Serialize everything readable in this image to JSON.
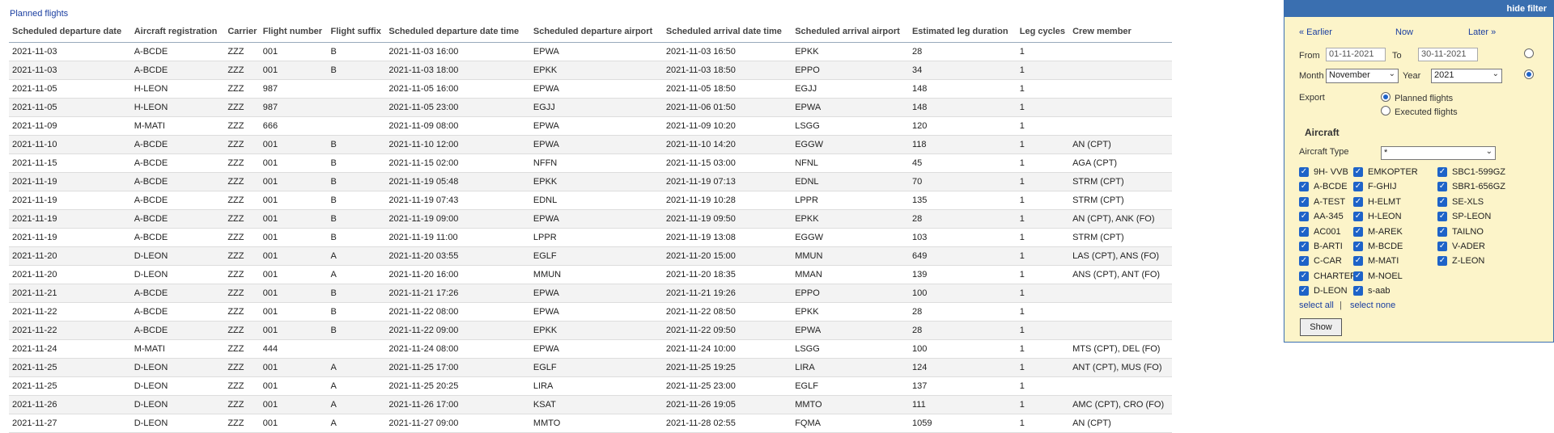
{
  "caption": "Planned flights",
  "columns": [
    "Scheduled departure date",
    "Aircraft registration",
    "Carrier",
    "Flight number",
    "Flight suffix",
    "Scheduled departure date time",
    "Scheduled departure airport",
    "Scheduled arrival date time",
    "Scheduled arrival airport",
    "Estimated leg duration",
    "Leg cycles",
    "Crew member"
  ],
  "rows": [
    [
      "2021-11-03",
      "A-BCDE",
      "ZZZ",
      "001",
      "B",
      "2021-11-03 16:00",
      "EPWA",
      "2021-11-03 16:50",
      "EPKK",
      "28",
      "1",
      ""
    ],
    [
      "2021-11-03",
      "A-BCDE",
      "ZZZ",
      "001",
      "B",
      "2021-11-03 18:00",
      "EPKK",
      "2021-11-03 18:50",
      "EPPO",
      "34",
      "1",
      ""
    ],
    [
      "2021-11-05",
      "H-LEON",
      "ZZZ",
      "987",
      "",
      "2021-11-05 16:00",
      "EPWA",
      "2021-11-05 18:50",
      "EGJJ",
      "148",
      "1",
      ""
    ],
    [
      "2021-11-05",
      "H-LEON",
      "ZZZ",
      "987",
      "",
      "2021-11-05 23:00",
      "EGJJ",
      "2021-11-06 01:50",
      "EPWA",
      "148",
      "1",
      ""
    ],
    [
      "2021-11-09",
      "M-MATI",
      "ZZZ",
      "666",
      "",
      "2021-11-09 08:00",
      "EPWA",
      "2021-11-09 10:20",
      "LSGG",
      "120",
      "1",
      ""
    ],
    [
      "2021-11-10",
      "A-BCDE",
      "ZZZ",
      "001",
      "B",
      "2021-11-10 12:00",
      "EPWA",
      "2021-11-10 14:20",
      "EGGW",
      "118",
      "1",
      "AN (CPT)"
    ],
    [
      "2021-11-15",
      "A-BCDE",
      "ZZZ",
      "001",
      "B",
      "2021-11-15 02:00",
      "NFFN",
      "2021-11-15 03:00",
      "NFNL",
      "45",
      "1",
      "AGA (CPT)"
    ],
    [
      "2021-11-19",
      "A-BCDE",
      "ZZZ",
      "001",
      "B",
      "2021-11-19 05:48",
      "EPKK",
      "2021-11-19 07:13",
      "EDNL",
      "70",
      "1",
      "STRM (CPT)"
    ],
    [
      "2021-11-19",
      "A-BCDE",
      "ZZZ",
      "001",
      "B",
      "2021-11-19 07:43",
      "EDNL",
      "2021-11-19 10:28",
      "LPPR",
      "135",
      "1",
      "STRM (CPT)"
    ],
    [
      "2021-11-19",
      "A-BCDE",
      "ZZZ",
      "001",
      "B",
      "2021-11-19 09:00",
      "EPWA",
      "2021-11-19 09:50",
      "EPKK",
      "28",
      "1",
      "AN (CPT), ANK (FO)"
    ],
    [
      "2021-11-19",
      "A-BCDE",
      "ZZZ",
      "001",
      "B",
      "2021-11-19 11:00",
      "LPPR",
      "2021-11-19 13:08",
      "EGGW",
      "103",
      "1",
      "STRM (CPT)"
    ],
    [
      "2021-11-20",
      "D-LEON",
      "ZZZ",
      "001",
      "A",
      "2021-11-20 03:55",
      "EGLF",
      "2021-11-20 15:00",
      "MMUN",
      "649",
      "1",
      "LAS (CPT), ANS (FO)"
    ],
    [
      "2021-11-20",
      "D-LEON",
      "ZZZ",
      "001",
      "A",
      "2021-11-20 16:00",
      "MMUN",
      "2021-11-20 18:35",
      "MMAN",
      "139",
      "1",
      "ANS (CPT), ANT (FO)"
    ],
    [
      "2021-11-21",
      "A-BCDE",
      "ZZZ",
      "001",
      "B",
      "2021-11-21 17:26",
      "EPWA",
      "2021-11-21 19:26",
      "EPPO",
      "100",
      "1",
      ""
    ],
    [
      "2021-11-22",
      "A-BCDE",
      "ZZZ",
      "001",
      "B",
      "2021-11-22 08:00",
      "EPWA",
      "2021-11-22 08:50",
      "EPKK",
      "28",
      "1",
      ""
    ],
    [
      "2021-11-22",
      "A-BCDE",
      "ZZZ",
      "001",
      "B",
      "2021-11-22 09:00",
      "EPKK",
      "2021-11-22 09:50",
      "EPWA",
      "28",
      "1",
      ""
    ],
    [
      "2021-11-24",
      "M-MATI",
      "ZZZ",
      "444",
      "",
      "2021-11-24 08:00",
      "EPWA",
      "2021-11-24 10:00",
      "LSGG",
      "100",
      "1",
      "MTS (CPT), DEL (FO)"
    ],
    [
      "2021-11-25",
      "D-LEON",
      "ZZZ",
      "001",
      "A",
      "2021-11-25 17:00",
      "EGLF",
      "2021-11-25 19:25",
      "LIRA",
      "124",
      "1",
      "ANT (CPT), MUS (FO)"
    ],
    [
      "2021-11-25",
      "D-LEON",
      "ZZZ",
      "001",
      "A",
      "2021-11-25 20:25",
      "LIRA",
      "2021-11-25 23:00",
      "EGLF",
      "137",
      "1",
      ""
    ],
    [
      "2021-11-26",
      "D-LEON",
      "ZZZ",
      "001",
      "A",
      "2021-11-26 17:00",
      "KSAT",
      "2021-11-26 19:05",
      "MMTO",
      "111",
      "1",
      "AMC (CPT), CRO (FO)"
    ],
    [
      "2021-11-27",
      "D-LEON",
      "ZZZ",
      "001",
      "A",
      "2021-11-27 09:00",
      "MMTO",
      "2021-11-28 02:55",
      "FQMA",
      "1059",
      "1",
      "AN (CPT)"
    ]
  ],
  "filter": {
    "hide_label": "hide filter",
    "earlier": "« Earlier",
    "now": "Now",
    "later": "Later »",
    "from_label": "From",
    "from_value": "01-11-2021",
    "to_label": "To",
    "to_value": "30-11-2021",
    "month_label": "Month",
    "month_value": "November",
    "year_label": "Year",
    "year_value": "2021",
    "export_label": "Export",
    "export_planned": "Planned flights",
    "export_executed": "Executed flights",
    "aircraft_heading": "Aircraft",
    "aircraft_type_label": "Aircraft Type",
    "aircraft_type_value": "*",
    "aircraft_col1": [
      "9H- VVB",
      "A-BCDE",
      "A-TEST",
      "AA-345",
      "AC001",
      "B-ARTI",
      "C-CAR",
      "CHARTER",
      "D-LEON"
    ],
    "aircraft_col2": [
      "EMKOPTER",
      "F-GHIJ",
      "H-ELMT",
      "H-LEON",
      "M-AREK",
      "M-BCDE",
      "M-MATI",
      "M-NOEL",
      "s-aab"
    ],
    "aircraft_col3": [
      "SBC1-599GZ",
      "SBR1-656GZ",
      "SE-XLS",
      "SP-LEON",
      "TAILNO",
      "V-ADER",
      "Z-LEON"
    ],
    "select_all": "select all",
    "separator": "|",
    "select_none": "select none",
    "show_label": "Show"
  },
  "colors": {
    "accent": "#3a6fb0",
    "panel_bg": "#fcf4c9",
    "link": "#1a3ea0",
    "check": "#1e63c8"
  }
}
